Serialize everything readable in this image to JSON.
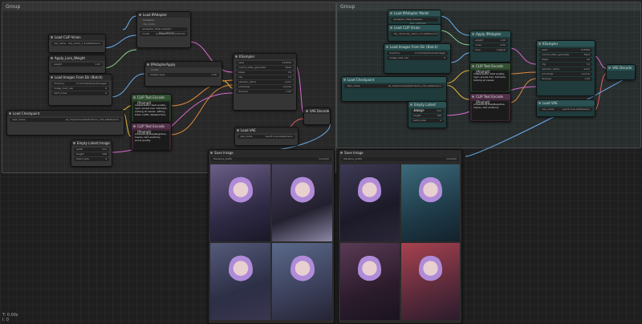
{
  "groups": [
    {
      "id": "g1",
      "title": "Group"
    },
    {
      "id": "g2",
      "title": "Group"
    }
  ],
  "nodes": {
    "lora_left": {
      "title": "Load IPAdapter",
      "w1": "ip-adapter-plus_sd15.bin",
      "w2": "ip-adapter-plus_sd15.bin"
    },
    "clip_vision_left": {
      "title": "Load CLIP Vision",
      "w1": "clip_vision_1.5.safetensors"
    },
    "apply_left": {
      "title": "Apply_Lora_Weight",
      "w1": "1.00"
    },
    "load_images_left": {
      "title": "Load Images From Dir (Batch)",
      "w1": "D:/ComfyUI/input/images",
      "w2": "0",
      "w3": "0"
    },
    "ksampler_left": {
      "title": "KSampler",
      "w1": "seed",
      "w2": "control_after_generate",
      "w3": "steps",
      "w4": "cfg",
      "w5": "sampler_name",
      "w6": "scheduler",
      "w7": "denoise"
    },
    "ipadapter_mid": {
      "title": "IPAdapterApply",
      "w1": "weight",
      "w2": "noise",
      "w3": "weight_type"
    },
    "clip_pos_left": {
      "title": "CLIP Text Encode (Prompt)",
      "text": "masterpiece, best quality, 1girl, purple hair, twintails, looking at viewer, sitting, black outfit, detailed face"
    },
    "clip_neg_left": {
      "title": "CLIP Text Encode (Prompt)",
      "text": "embedding:EasyNegative, lowres, bad anatomy, worst quality"
    },
    "checkpoint_left": {
      "title": "Load Checkpoint",
      "w1": "sd_15/anime/realisticVision_v51.safetensors"
    },
    "vae_decode_left": {
      "title": "VAE Decode"
    },
    "empty_latent_left": {
      "title": "Empty Latent Image",
      "w1": "512",
      "w2": "768",
      "w3": "4"
    },
    "load_vae_left": {
      "title": "Load VAE",
      "w1": "vae-ft-mse.safetensors"
    },
    "save_left": {
      "title": "Save Image",
      "prefix": "ComfyUI",
      "prefix_label": "filename_prefix"
    },
    "ipadapter_right_model": {
      "title": "Load IPAdapter Model",
      "w1": "ip-adapter-plus_sd15.bin"
    },
    "clip_vision_right": {
      "title": "Load CLIP Vision",
      "w1": "clip_vision_1.5.safetensors"
    },
    "load_images_right": {
      "title": "Load Images From Dir (Batch)",
      "w1": "D:/ComfyUI/input/images",
      "w2": "0",
      "w3": "0"
    },
    "apply_right": {
      "title": "Apply IPAdapter",
      "w1": "1.00",
      "w2": "0.00",
      "w3": "original"
    },
    "ksampler_right": {
      "title": "KSampler",
      "w1": "seed",
      "w2": "control_after_generate",
      "w3": "steps",
      "w4": "cfg",
      "w5": "sampler_name",
      "w6": "scheduler",
      "w7": "denoise"
    },
    "checkpoint_right": {
      "title": "Load Checkpoint",
      "w1": "sd_15/anime/realisticVision_v51.safetensors"
    },
    "clip_pos_right": {
      "title": "CLIP Text Encode (Prompt)",
      "text": "masterpiece, best quality, 1girl, purple hair, twintails, looking at viewer"
    },
    "clip_neg_right": {
      "title": "CLIP Text Encode (Prompt)",
      "text": "embedding:EasyNegative, lowres, bad anatomy"
    },
    "empty_latent_right": {
      "title": "Empty Latent Image",
      "w1": "512",
      "w2": "768",
      "w3": "4"
    },
    "load_vae_right": {
      "title": "Load VAE",
      "w1": "vae-ft-mse.safetensors"
    },
    "vae_decode_right": {
      "title": "VAE Decode"
    },
    "save_right": {
      "title": "Save Image",
      "prefix": "ComfyUI",
      "prefix_label": "filename_prefix"
    }
  },
  "status": {
    "line1": "T: 0.00s",
    "line2": "I: 0"
  },
  "colors": {
    "link_blue": "#6ab0f3",
    "link_yellow": "#e0b43c",
    "link_pink": "#d86ad1",
    "link_orange": "#e08a3c",
    "link_green": "#8fd18f",
    "link_red": "#e06060"
  }
}
